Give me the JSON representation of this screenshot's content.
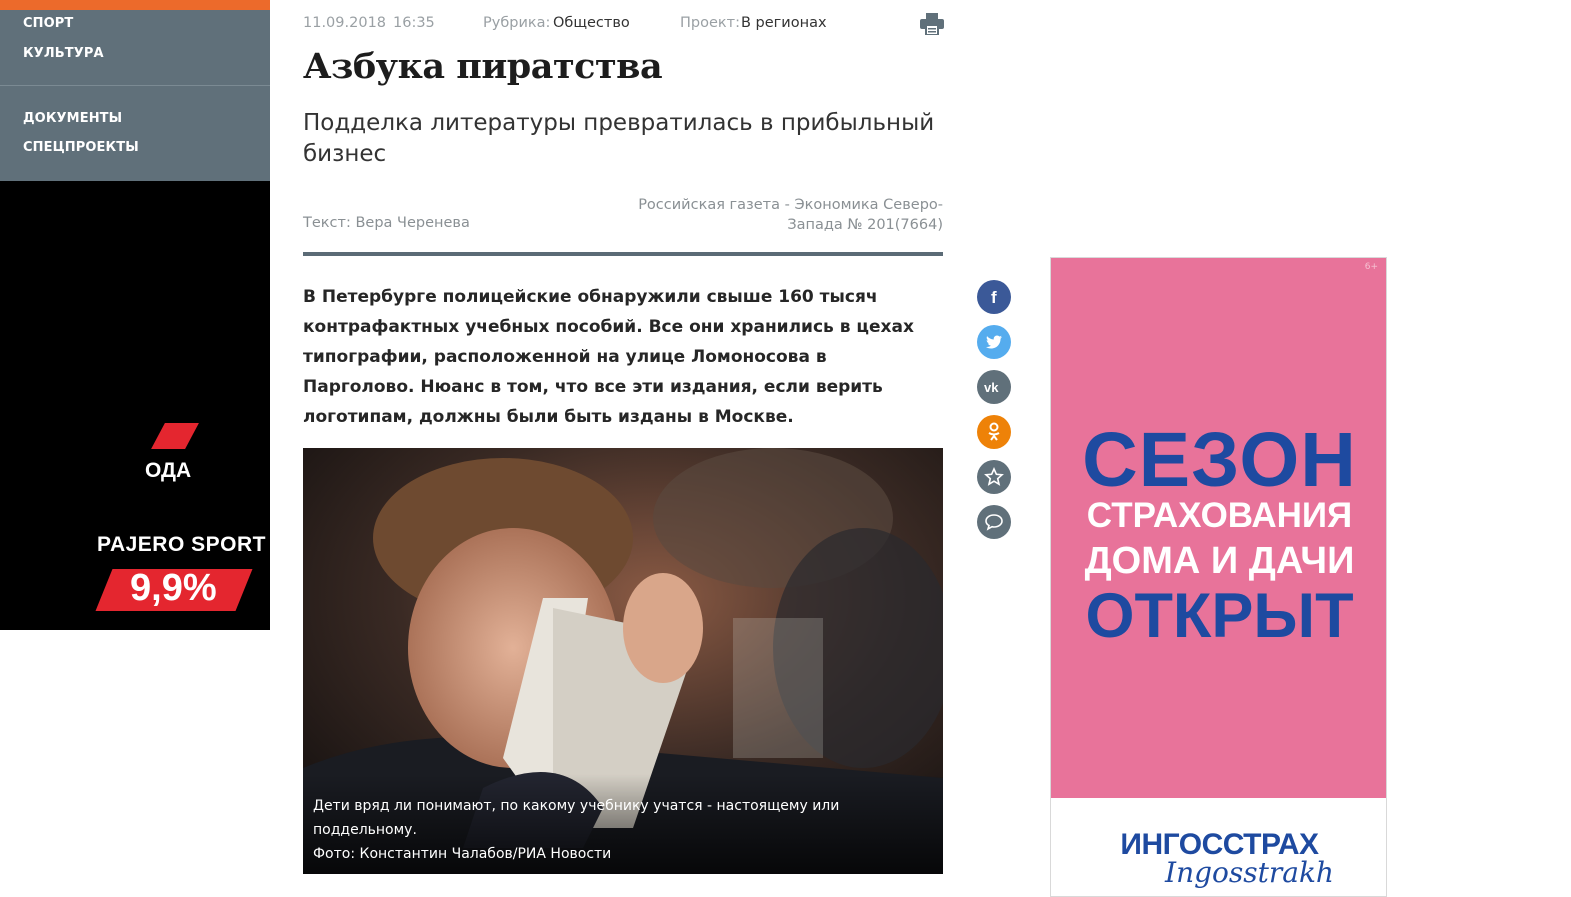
{
  "sidebar": {
    "items": [
      {
        "label": "СПОРТ"
      },
      {
        "label": "КУЛЬТУРА"
      },
      {
        "label": "ДОКУМЕНТЫ"
      },
      {
        "label": "СПЕЦПРОЕКТЫ"
      }
    ],
    "ad": {
      "line1": "ОДА",
      "model": "PAJERO SPORT",
      "rate": "9,9%"
    }
  },
  "article": {
    "date": "11.09.2018",
    "time": "16:35",
    "rubric_label": "Рубрика:",
    "rubric_value": "Общество",
    "project_label": "Проект:",
    "project_value": "В регионах",
    "title": "Азбука пиратства",
    "subtitle": "Подделка литературы превратилась в прибыльный бизнес",
    "author": "Текст: Вера Черенева",
    "source_line1": "Российская газета - Экономика Северо-",
    "source_line2": "Запада № 201(7664)",
    "lead": "В Петербурге полицейские обнаружили свыше 160 тысяч контрафактных учебных пособий. Все они хранились в цехах типографии, расположенной на улице Ломоносова в Парголово. Нюанс в том, что все эти издания, если верить логотипам, должны были быть изданы в Москве.",
    "photo_caption": "Дети вряд ли понимают, по какому учебнику учатся - настоящему или поддельному.",
    "photo_credit": "Фото: Константин Чалабов/РИА Новости"
  },
  "social": [
    {
      "icon": "facebook-icon",
      "color": "#3b5998"
    },
    {
      "icon": "twitter-icon",
      "color": "#55acee"
    },
    {
      "icon": "vk-icon",
      "color": "#4a76a8"
    },
    {
      "icon": "odnoklassniki-icon",
      "color": "#ee8208"
    },
    {
      "icon": "star-icon",
      "color": "#60707a"
    },
    {
      "icon": "comment-icon",
      "color": "#60707a"
    }
  ],
  "right_ad": {
    "age": "6+",
    "word1": "СЕЗОН",
    "word2": "СТРАХОВАНИЯ",
    "word3": "ДОМА И ДАЧИ",
    "word4": "ОТКРЫТ",
    "brand": "ИНГОССТРАХ",
    "brand_script": "Ingosstrakh",
    "colors": {
      "pink": "#e8739a",
      "blue": "#1e4aa0"
    }
  },
  "colors": {
    "sidebar": "#60707a",
    "accent": "#ec6a2b",
    "rule": "#5b6b76"
  }
}
